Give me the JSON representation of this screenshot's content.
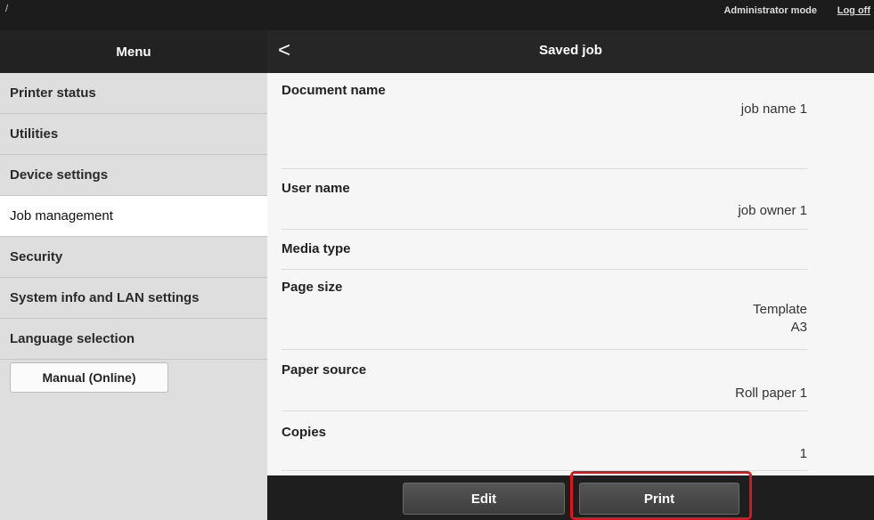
{
  "topbar": {
    "slash": "/",
    "mode": "Administrator mode",
    "logoff": "Log off"
  },
  "sidebar": {
    "title": "Menu",
    "items": [
      {
        "label": "Printer status",
        "active": false
      },
      {
        "label": "Utilities",
        "active": false
      },
      {
        "label": "Device settings",
        "active": false
      },
      {
        "label": "Job management",
        "active": true
      },
      {
        "label": "Security",
        "active": false
      },
      {
        "label": "System info and LAN settings",
        "active": false
      },
      {
        "label": "Language selection",
        "active": false
      }
    ],
    "manual_button": "Manual (Online)"
  },
  "header": {
    "back_icon": "<",
    "title": "Saved job"
  },
  "fields": [
    {
      "label": "Document name",
      "value_lines": [
        "job name 1"
      ]
    },
    {
      "label": "User name",
      "value_lines": [
        "job owner 1"
      ]
    },
    {
      "label": "Media type",
      "value_lines": []
    },
    {
      "label": "Page size",
      "value_lines": [
        "Template",
        "A3"
      ]
    },
    {
      "label": "Paper source",
      "value_lines": [
        "Roll paper 1"
      ]
    },
    {
      "label": "Copies",
      "value_lines": [
        "1"
      ]
    }
  ],
  "footer": {
    "edit_label": "Edit",
    "print_label": "Print"
  },
  "colors": {
    "highlight": "#e0151b",
    "header_bg": "#222222",
    "sidebar_bg": "#dedede"
  }
}
